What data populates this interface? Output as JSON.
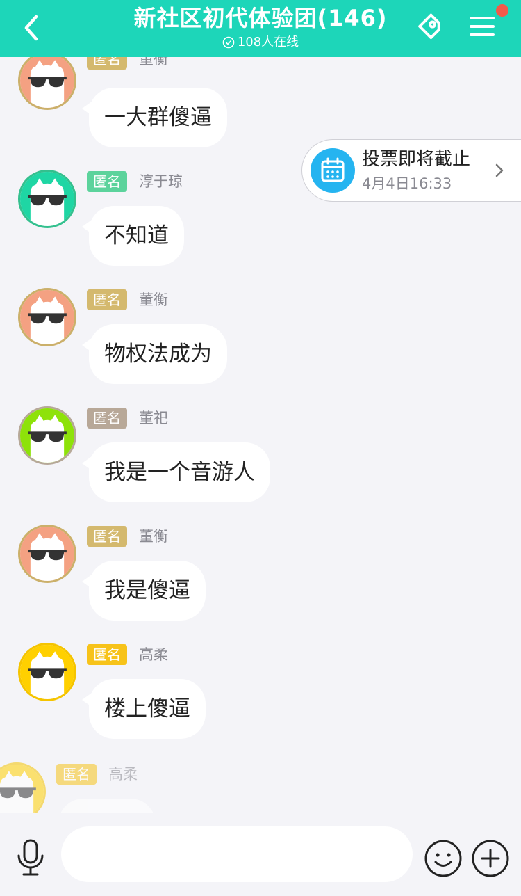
{
  "header": {
    "title": "新社区初代体验团(146)",
    "online": "108人在线",
    "accent": "#1dd6b9"
  },
  "vote_notice": {
    "title": "投票即将截止",
    "time": "4月4日16:33"
  },
  "messages": [
    {
      "badge": "匿名",
      "sender": "董衡",
      "text": "一大群傻逼",
      "badge_color": "#d4b96e",
      "avatar_bg": "#f4a182",
      "avatar_ring": "#cbb06a"
    },
    {
      "badge": "匿名",
      "sender": "淳于琼",
      "text": "不知道",
      "badge_color": "#5cd39c",
      "avatar_bg": "#1fd6a4",
      "avatar_ring": "#34c08e"
    },
    {
      "badge": "匿名",
      "sender": "董衡",
      "text": "物权法成为",
      "badge_color": "#d4b96e",
      "avatar_bg": "#f4a182",
      "avatar_ring": "#cbb06a"
    },
    {
      "badge": "匿名",
      "sender": "董祀",
      "text": "我是一个音游人",
      "badge_color": "#b8a898",
      "avatar_bg": "#8ee20a",
      "avatar_ring": "#b6a898"
    },
    {
      "badge": "匿名",
      "sender": "董衡",
      "text": "我是傻逼",
      "badge_color": "#d4b96e",
      "avatar_bg": "#f4a182",
      "avatar_ring": "#cbb06a"
    },
    {
      "badge": "匿名",
      "sender": "高柔",
      "text": "楼上傻逼",
      "badge_color": "#f7c31a",
      "avatar_bg": "#ffd000",
      "avatar_ring": "#f5c400"
    },
    {
      "badge": "匿名",
      "sender": "高柔",
      "text": "",
      "badge_color": "#f7c31a",
      "avatar_bg": "#ffd000",
      "avatar_ring": "#f5c400"
    }
  ],
  "input": {
    "placeholder": ""
  },
  "icons": {
    "back": "chevron-left-icon",
    "tag": "tag-link-icon",
    "menu": "hamburger-menu-icon",
    "mic": "microphone-icon",
    "emoji": "smiley-icon",
    "plus": "plus-circle-icon"
  }
}
